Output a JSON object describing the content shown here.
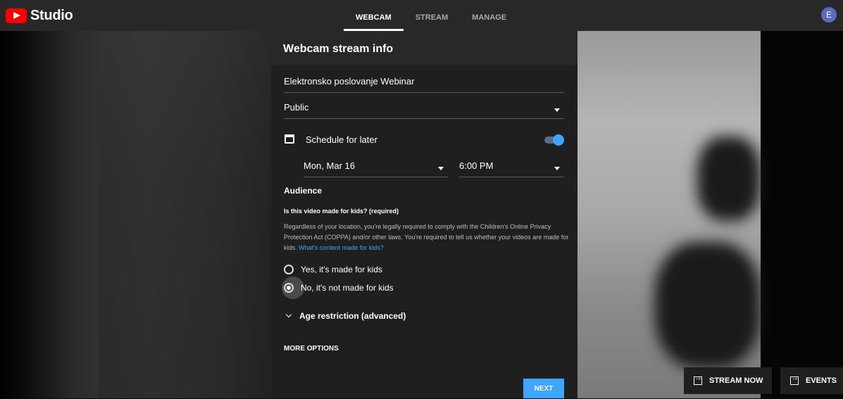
{
  "app": {
    "brand": "Studio",
    "avatar_initial": "E"
  },
  "tabs": [
    {
      "label": "WEBCAM",
      "active": true
    },
    {
      "label": "STREAM",
      "active": false
    },
    {
      "label": "MANAGE",
      "active": false
    }
  ],
  "panel": {
    "header": "Webcam stream info",
    "title_value": "Elektronsko poslovanje Webinar",
    "privacy_value": "Public",
    "schedule_label": "Schedule for later",
    "schedule_enabled": true,
    "date_value": "Mon, Mar 16",
    "time_value": "6:00 PM",
    "audience_heading": "Audience",
    "kids_question": "Is this video made for kids? (required)",
    "kids_description": "Regardless of your location, you're legally required to comply with the Children's Online Privacy Protection Act (COPPA) and/or other laws. You're required to tell us whether your videos are made for kids.",
    "kids_link": "What's content made for kids?",
    "option_yes": "Yes, it's made for kids",
    "option_no": "No, it's not made for kids",
    "selected_option": "no",
    "age_restriction": "Age restriction (advanced)",
    "more_options": "MORE OPTIONS",
    "next_label": "NEXT"
  },
  "actions": {
    "stream_now": "STREAM NOW",
    "events": "EVENTS"
  },
  "colors": {
    "accent": "#3ea6ff",
    "brand_red": "#ff0000"
  }
}
